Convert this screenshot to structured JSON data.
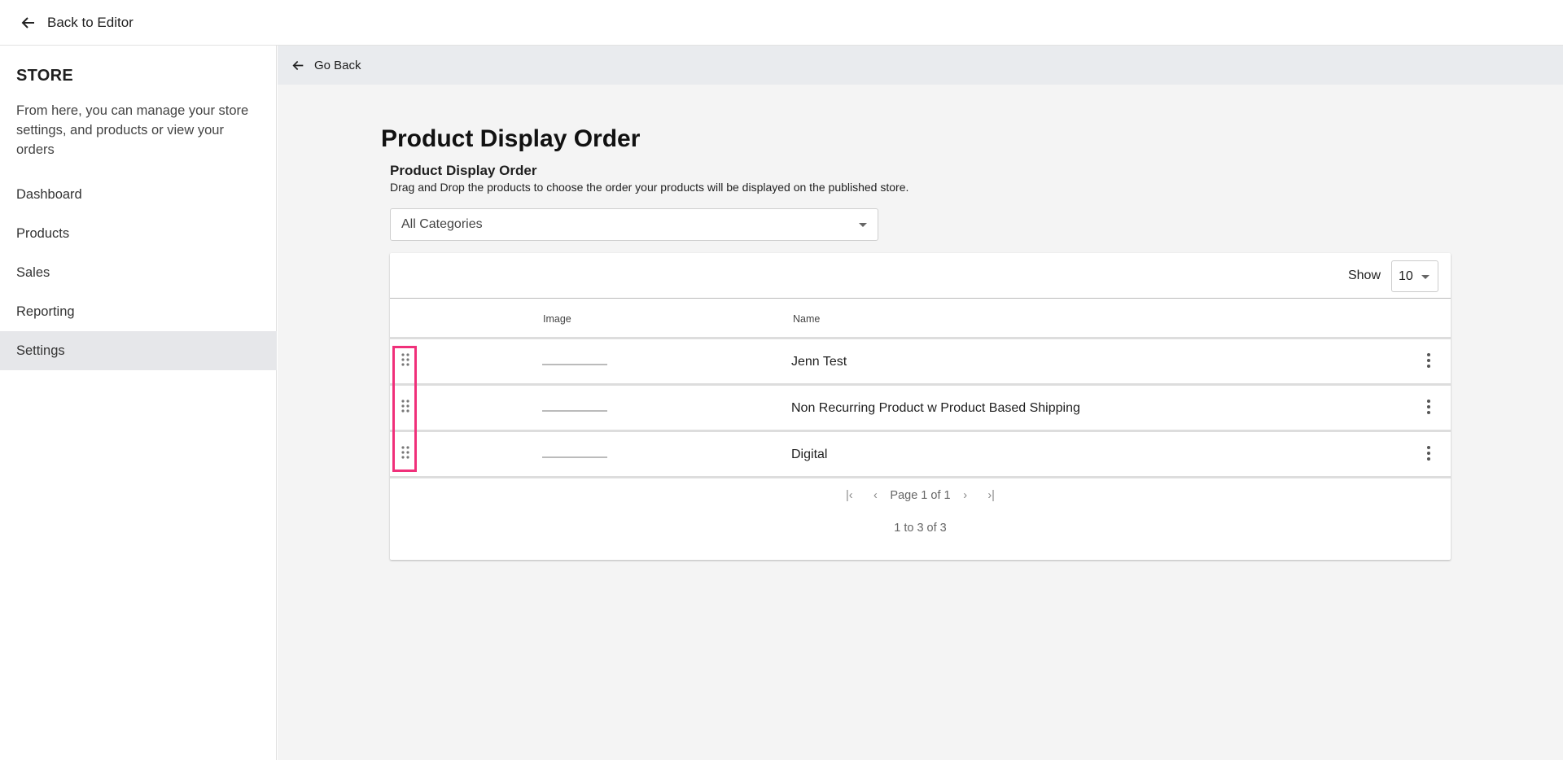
{
  "topbar": {
    "back_label": "Back to Editor"
  },
  "sidebar": {
    "title": "STORE",
    "description": "From here, you can manage your store settings, and products or view your orders",
    "items": [
      {
        "label": "Dashboard"
      },
      {
        "label": "Products"
      },
      {
        "label": "Sales"
      },
      {
        "label": "Reporting"
      },
      {
        "label": "Settings",
        "active": true
      }
    ]
  },
  "main": {
    "go_back": "Go Back",
    "title": "Product Display Order",
    "section_title": "Product Display Order",
    "hint": "Drag and Drop the products to choose the order your products will be displayed on the published store.",
    "category_select": "All Categories",
    "table": {
      "show_label": "Show",
      "per_page": "10",
      "columns": [
        "Image",
        "Name"
      ],
      "rows": [
        {
          "name": "Jenn Test"
        },
        {
          "name": "Non Recurring Product w Product Based Shipping"
        },
        {
          "name": "Digital"
        }
      ],
      "page_label": "Page 1 of 1",
      "count_label": "1 to 3 of 3"
    }
  },
  "colors": {
    "highlight": "#f0307a",
    "active_bg": "#e6e7ea"
  }
}
